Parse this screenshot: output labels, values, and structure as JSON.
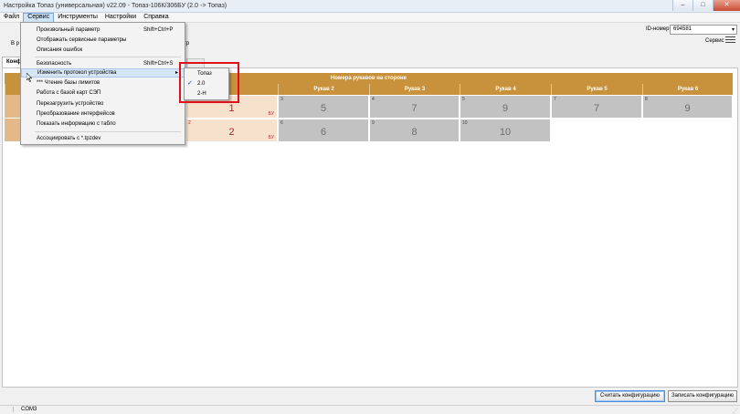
{
  "window": {
    "title": "Настройка Топаз (универсальная) v22.09 - Топаз-106К/306БУ (2.0 -> Топаз)",
    "controls": {
      "minimize": "–",
      "maximize": "□",
      "close": "✕"
    }
  },
  "menubar": {
    "items": [
      "Файл",
      "Сервис",
      "Инструменты",
      "Настройки",
      "Справка"
    ]
  },
  "toolbar": {
    "id_label": "ID-номер",
    "id_value": "694581",
    "service_label": "Сервис",
    "left_cut_text": "В р",
    "right_cut_text": "тр"
  },
  "tabs": {
    "active": "Конф"
  },
  "grid": {
    "title": "Номера рукавов на стороне",
    "headers": [
      "Рукав 2",
      "Рукав 3",
      "Рукав 4",
      "Рукав 5",
      "Рукав 6"
    ],
    "row1": [
      {
        "num": "1",
        "value": "1",
        "bu": "БУ"
      },
      {
        "num": "3",
        "value": "5"
      },
      {
        "num": "4",
        "value": "7"
      },
      {
        "num": "5",
        "value": "9"
      },
      {
        "num": "7",
        "value": "7"
      },
      {
        "num": "8",
        "value": "9"
      }
    ],
    "row2": [
      {
        "num": "2",
        "value": "2",
        "bu": "БУ"
      },
      {
        "num": "6",
        "value": "6"
      },
      {
        "num": "9",
        "value": "8"
      },
      {
        "num": "10",
        "value": "10"
      }
    ]
  },
  "service_menu": {
    "items": [
      {
        "label": "Произвольный параметр",
        "shortcut": "Shift+Ctrl+P"
      },
      {
        "label": "Отображать сервисные параметры",
        "shortcut": ""
      },
      {
        "label": "Описания ошибок",
        "shortcut": ""
      },
      {
        "label": "Безопасность",
        "shortcut": "Shift+Ctrl+S"
      },
      {
        "label": "Изменить протокол устройства",
        "shortcut": "",
        "submenu_arrow": "▸"
      },
      {
        "label": "*** Чтение базы лимитов",
        "shortcut": ""
      },
      {
        "label": "Работа с базой карт СЭП",
        "shortcut": ""
      },
      {
        "label": "Перезагрузить устройство",
        "shortcut": ""
      },
      {
        "label": "Преобразование интерфейсов",
        "shortcut": ""
      },
      {
        "label": "Показать информацию с табло",
        "shortcut": ""
      },
      {
        "label": "Ассоциировать с *.tpzdev",
        "shortcut": ""
      }
    ]
  },
  "protocol_submenu": {
    "items": [
      {
        "label": "Топаз",
        "checked": false
      },
      {
        "label": "2.0",
        "checked": true,
        "check_mark": "✓"
      },
      {
        "label": "2-Н",
        "checked": false
      }
    ],
    "highlight_color": "#e1111a"
  },
  "buttons": {
    "read_config": "Считать конфигурацию",
    "write_config": "Записать конфигурацию"
  },
  "statusbar": {
    "port": "COM3",
    "grip": "⋰"
  }
}
